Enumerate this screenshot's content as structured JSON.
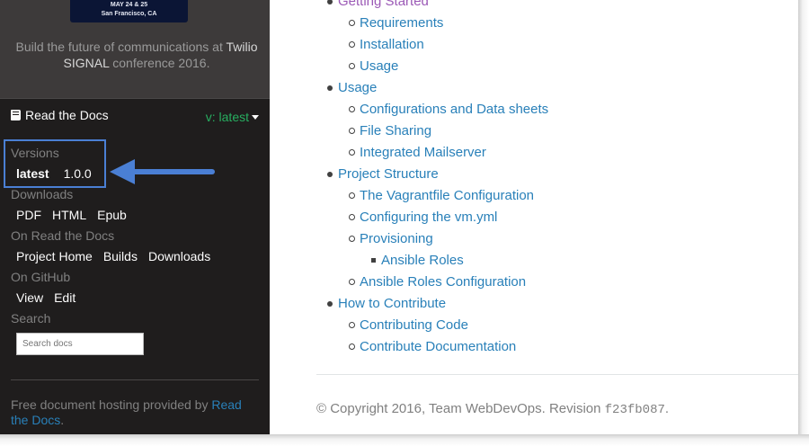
{
  "promo": {
    "banner_line1": "MAY 24 & 25",
    "banner_line2": "San Francisco, CA",
    "text_prefix": "Build the future of communications at ",
    "text_highlight": "Twilio SIGNAL",
    "text_suffix": " conference 2016",
    "text_end": "."
  },
  "rtd": {
    "brand": "Read the Docs",
    "current_version": "v: latest",
    "versions_title": "Versions",
    "versions": [
      "latest",
      "1.0.0"
    ],
    "downloads_title": "Downloads",
    "downloads": [
      "PDF",
      "HTML",
      "Epub"
    ],
    "on_rtd_title": "On Read the Docs",
    "on_rtd_links": [
      "Project Home",
      "Builds",
      "Downloads"
    ],
    "on_github_title": "On GitHub",
    "on_github_links": [
      "View",
      "Edit"
    ],
    "search_title": "Search",
    "search_placeholder": "Search docs",
    "hosting_prefix": "Free document hosting provided by ",
    "hosting_link": "Read the Docs",
    "hosting_suffix": "."
  },
  "toc": [
    {
      "label": "Getting Started",
      "level": 1
    },
    {
      "label": "Requirements",
      "level": 2
    },
    {
      "label": "Installation",
      "level": 2
    },
    {
      "label": "Usage",
      "level": 2
    },
    {
      "label": "Usage",
      "level": 1
    },
    {
      "label": "Configurations and Data sheets",
      "level": 2
    },
    {
      "label": "File Sharing",
      "level": 2
    },
    {
      "label": "Integrated Mailserver",
      "level": 2
    },
    {
      "label": "Project Structure",
      "level": 1
    },
    {
      "label": "The Vagrantfile Configuration",
      "level": 2
    },
    {
      "label": "Configuring the vm.yml",
      "level": 2
    },
    {
      "label": "Provisioning",
      "level": 2
    },
    {
      "label": "Ansible Roles",
      "level": 3
    },
    {
      "label": "Ansible Roles Configuration",
      "level": 2
    },
    {
      "label": "How to Contribute",
      "level": 1
    },
    {
      "label": "Contributing Code",
      "level": 2
    },
    {
      "label": "Contribute Documentation",
      "level": 2
    }
  ],
  "footer": {
    "copyright": "© Copyright 2016, Team WebDevOps. Revision ",
    "revision": "f23fb087",
    "end": "."
  },
  "colors": {
    "link": "#2980b9",
    "visited_link": "#9b59b6",
    "version_green": "#27ae60",
    "highlight_blue": "#4a7fd4"
  }
}
